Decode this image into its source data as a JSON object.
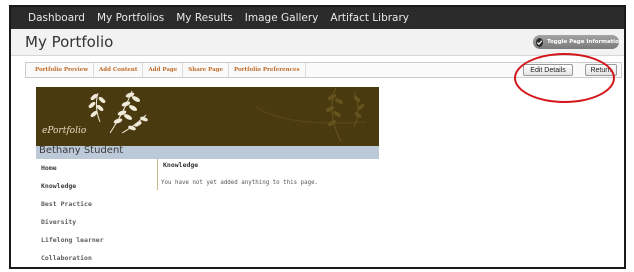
{
  "topnav": {
    "items": [
      {
        "label": "Dashboard"
      },
      {
        "label": "My Portfolios"
      },
      {
        "label": "My Results"
      },
      {
        "label": "Image Gallery"
      },
      {
        "label": "Artifact Library"
      }
    ]
  },
  "header": {
    "title": "My Portfolio",
    "toggle_label": "Toggle Page Information"
  },
  "toolbar": {
    "tabs": [
      {
        "label": "Portfolio Preview"
      },
      {
        "label": "Add Content"
      },
      {
        "label": "Add Page"
      },
      {
        "label": "Share Page"
      },
      {
        "label": "Portfolio Preferences"
      }
    ],
    "edit_details_label": "Edit Details",
    "return_label": "Return"
  },
  "banner": {
    "logo_text": "ePortfolio",
    "owner_name": "Bethany Student"
  },
  "sidebar": {
    "items": [
      {
        "label": "Home",
        "active": true
      },
      {
        "label": "Knowledge",
        "active": true
      },
      {
        "label": "Best Practice",
        "active": false
      },
      {
        "label": "Diversity",
        "active": false
      },
      {
        "label": "Lifelong learner",
        "active": false
      },
      {
        "label": "Collaboration",
        "active": false
      }
    ]
  },
  "main": {
    "heading": "Knowledge",
    "empty_message": "You have not yet added anything to this page."
  },
  "colors": {
    "topnav_bg": "#2b2b2b",
    "tab_text": "#c06a26",
    "banner_bg": "#4a3a10",
    "namebar_bg": "#bcc9d8",
    "highlight": "#d4161b"
  }
}
